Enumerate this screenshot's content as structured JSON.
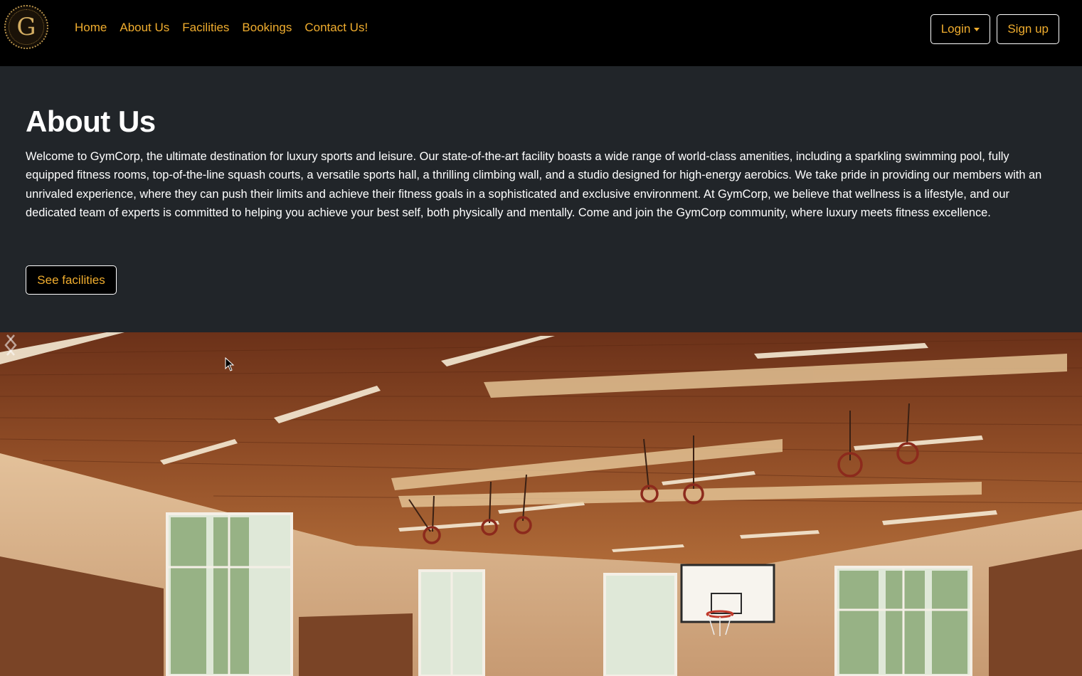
{
  "navbar": {
    "logo_letter": "G",
    "links": [
      "Home",
      "About Us",
      "Facilities",
      "Bookings",
      "Contact Us!"
    ],
    "login_label": "Login",
    "signup_label": "Sign up"
  },
  "about": {
    "title": "About Us",
    "body": "Welcome to GymCorp, the ultimate destination for luxury sports and leisure. Our state-of-the-art facility boasts a wide range of world-class amenities, including a sparkling swimming pool, fully equipped fitness rooms, top-of-the-line squash courts, a versatile sports hall, a thrilling climbing wall, and a studio designed for high-energy aerobics. We take pride in providing our members with an unrivaled experience, where they can push their limits and achieve their fitness goals in a sophisticated and exclusive environment. At GymCorp, we believe that wellness is a lifestyle, and our dedicated team of experts is committed to helping you achieve your best self, both physically and mentally. Come and join the GymCorp community, where luxury meets fitness excellence.",
    "button_label": "See facilities"
  },
  "hero": {
    "icons": {
      "prev": "chevron-left-icon",
      "next": "chevron-right-icon"
    }
  },
  "colors": {
    "accent": "#f0ad2e",
    "navbar_bg": "#000000",
    "section_bg": "#212529"
  }
}
